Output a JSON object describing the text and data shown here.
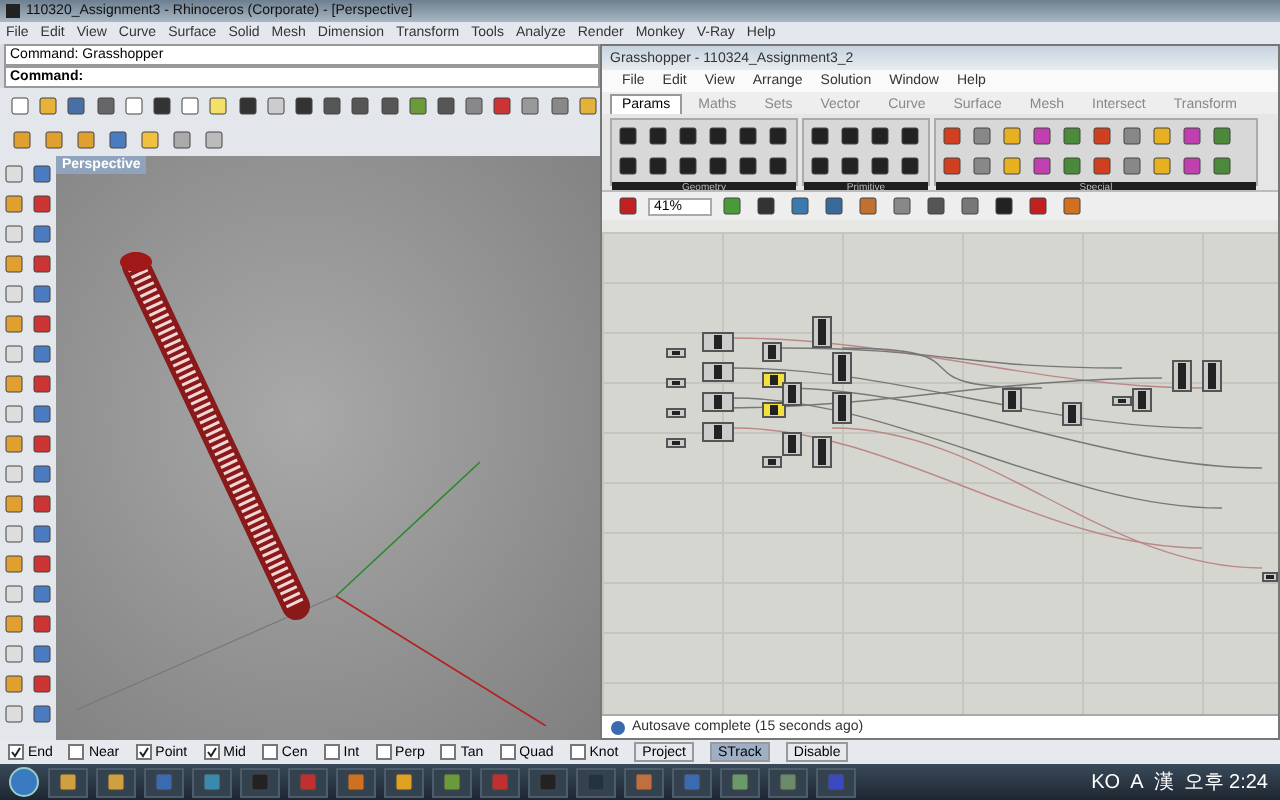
{
  "window": {
    "title": "110320_Assignment3 - Rhinoceros (Corporate) - [Perspective]"
  },
  "menu": [
    "File",
    "Edit",
    "View",
    "Curve",
    "Surface",
    "Solid",
    "Mesh",
    "Dimension",
    "Transform",
    "Tools",
    "Analyze",
    "Render",
    "Monkey",
    "V-Ray",
    "Help"
  ],
  "command_history": "Command: Grasshopper",
  "command_prompt": "Command:",
  "viewport": {
    "label": "Perspective"
  },
  "grasshopper": {
    "title": "Grasshopper - 110324_Assignment3_2",
    "menu": [
      "File",
      "Edit",
      "View",
      "Arrange",
      "Solution",
      "Window",
      "Help"
    ],
    "tabs": [
      {
        "label": "Params",
        "selected": true
      },
      {
        "label": "Maths",
        "selected": false
      },
      {
        "label": "Sets",
        "selected": false
      },
      {
        "label": "Vector",
        "selected": false
      },
      {
        "label": "Curve",
        "selected": false
      },
      {
        "label": "Surface",
        "selected": false
      },
      {
        "label": "Mesh",
        "selected": false
      },
      {
        "label": "Intersect",
        "selected": false
      },
      {
        "label": "Transform",
        "selected": false
      }
    ],
    "panels": [
      "Geometry",
      "Primitive",
      "Special"
    ],
    "zoom": "41%",
    "status": "Autosave complete (15 seconds ago)"
  },
  "osnaps": [
    {
      "label": "End",
      "checked": true
    },
    {
      "label": "Near",
      "checked": false
    },
    {
      "label": "Point",
      "checked": true
    },
    {
      "label": "Mid",
      "checked": true
    },
    {
      "label": "Cen",
      "checked": false
    },
    {
      "label": "Int",
      "checked": false
    },
    {
      "label": "Perp",
      "checked": false
    },
    {
      "label": "Tan",
      "checked": false
    },
    {
      "label": "Quad",
      "checked": false
    },
    {
      "label": "Knot",
      "checked": false
    }
  ],
  "mode_buttons": [
    {
      "label": "Project",
      "selected": false
    },
    {
      "label": "STrack",
      "selected": true
    },
    {
      "label": "Disable",
      "selected": false
    }
  ],
  "taskbar": {
    "tray": [
      "KO",
      "A",
      "漢"
    ],
    "clock": "오후 2:24"
  }
}
